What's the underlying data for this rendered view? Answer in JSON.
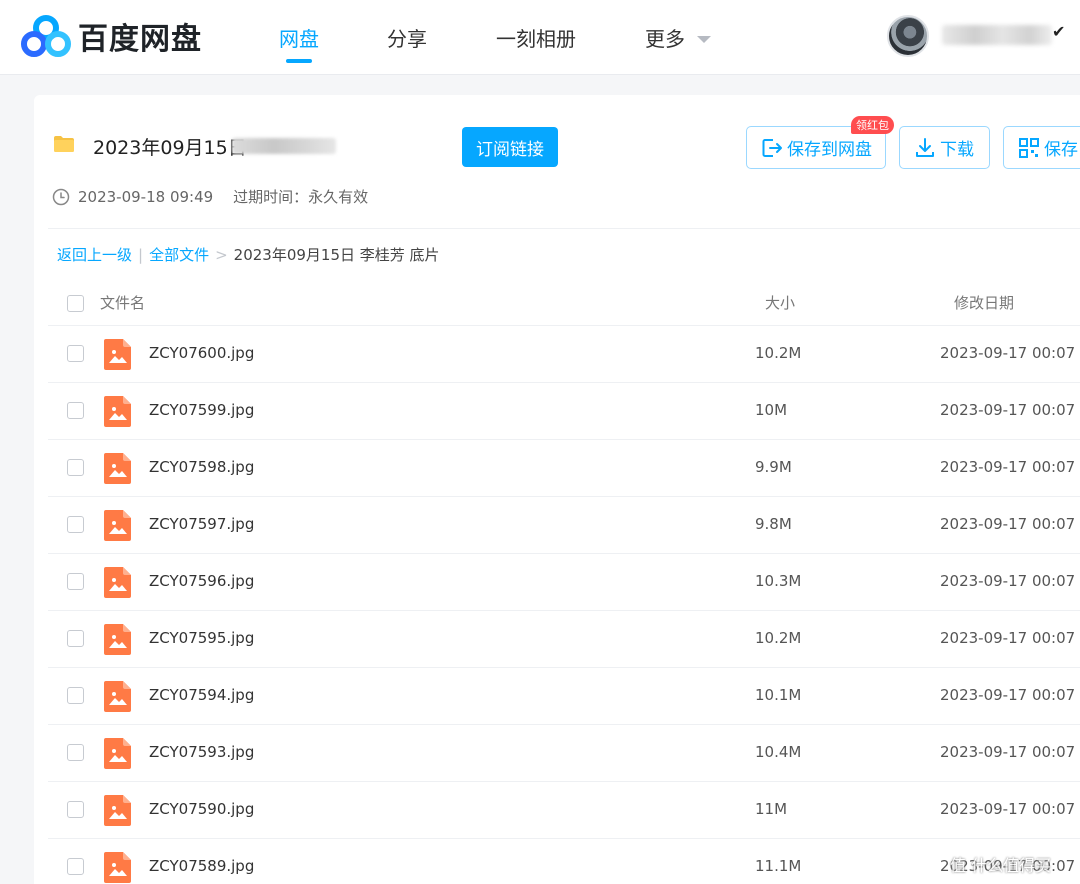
{
  "app": {
    "name": "百度网盘"
  },
  "nav": [
    {
      "label": "网盘",
      "active": true
    },
    {
      "label": "分享",
      "active": false
    },
    {
      "label": "一刻相册",
      "active": false
    },
    {
      "label": "更多",
      "active": false
    }
  ],
  "share": {
    "title": "2023年09月15日",
    "created": "2023-09-18 09:49",
    "expire": "过期时间：永久有效",
    "subscribe_label": "订阅链接",
    "save_label": "保存到网盘",
    "save_badge": "领红包",
    "download_label": "下载",
    "save2_label": "保存"
  },
  "breadcrumb": {
    "back": "返回上一级",
    "all_files": "全部文件",
    "current": "2023年09月15日 李桂芳 底片"
  },
  "table": {
    "headers": {
      "name": "文件名",
      "size": "大小",
      "date": "修改日期"
    },
    "rows": [
      {
        "name": "ZCY07600.jpg",
        "size": "10.2M",
        "date": "2023-09-17 00:07"
      },
      {
        "name": "ZCY07599.jpg",
        "size": "10M",
        "date": "2023-09-17 00:07"
      },
      {
        "name": "ZCY07598.jpg",
        "size": "9.9M",
        "date": "2023-09-17 00:07"
      },
      {
        "name": "ZCY07597.jpg",
        "size": "9.8M",
        "date": "2023-09-17 00:07"
      },
      {
        "name": "ZCY07596.jpg",
        "size": "10.3M",
        "date": "2023-09-17 00:07"
      },
      {
        "name": "ZCY07595.jpg",
        "size": "10.2M",
        "date": "2023-09-17 00:07"
      },
      {
        "name": "ZCY07594.jpg",
        "size": "10.1M",
        "date": "2023-09-17 00:07"
      },
      {
        "name": "ZCY07593.jpg",
        "size": "10.4M",
        "date": "2023-09-17 00:07"
      },
      {
        "name": "ZCY07590.jpg",
        "size": "11M",
        "date": "2023-09-17 00:07"
      },
      {
        "name": "ZCY07589.jpg",
        "size": "11.1M",
        "date": "2023-09-17 00:07"
      }
    ]
  },
  "watermark": "值 什么值得买",
  "colors": {
    "accent": "#06a7ff",
    "file_icon": "#ff7a45",
    "badge": "#ff4d4f"
  },
  "icons": [
    "baidu-netdisk-logo",
    "folder-icon",
    "clock-icon",
    "save-icon",
    "download-icon",
    "save-qr-icon",
    "image-file-icon"
  ]
}
